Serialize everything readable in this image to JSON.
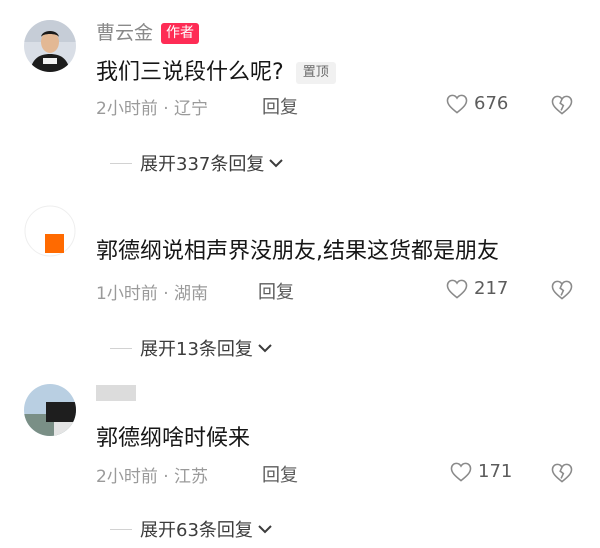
{
  "comments": [
    {
      "username": "曹云金",
      "author_tag": "作者",
      "text": "我们三说段什么呢?",
      "pin_tag": "置顶",
      "meta": "2小时前 · 辽宁",
      "reply_label": "回复",
      "likes": "676",
      "expand_label": "展开337条回复"
    },
    {
      "username": "",
      "text": "郭德纲说相声界没朋友,结果这货都是朋友",
      "meta": "1小时前 · 湖南",
      "reply_label": "回复",
      "likes": "217",
      "expand_label": "展开13条回复"
    },
    {
      "username": "",
      "text": "郭德纲啥时候来",
      "meta": "2小时前 · 江苏",
      "reply_label": "回复",
      "likes": "171",
      "expand_label": "展开63条回复"
    }
  ],
  "icons": {
    "like": "heart-outline-icon",
    "dislike": "broken-heart-icon",
    "expand": "chevron-down-icon"
  },
  "colors": {
    "author_tag": "#fe2c55",
    "avatar_square": "#ff6a00",
    "muted_text": "#9a9a9a"
  }
}
